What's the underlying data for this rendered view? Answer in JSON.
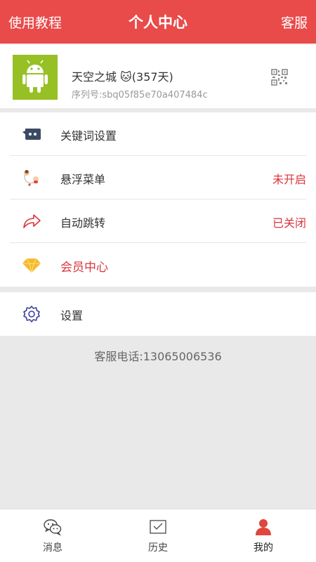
{
  "header": {
    "left_label": "使用教程",
    "title": "个人中心",
    "right_label": "客服"
  },
  "profile": {
    "name": "天空之城 🐱(357天)",
    "serial": "序列号:sbq05f85e70a407484c",
    "avatar_icon": "android-icon",
    "qr_icon": "qr-code-icon"
  },
  "menu": {
    "items": [
      {
        "label": "关键词设置",
        "status": "",
        "icon": "keyword-chat-icon"
      },
      {
        "label": "悬浮菜单",
        "status": "未开启",
        "icon": "floating-menu-icon"
      },
      {
        "label": "自动跳转",
        "status": "已关闭",
        "icon": "redirect-arrow-icon"
      },
      {
        "label": "会员中心",
        "status": "",
        "icon": "diamond-icon"
      }
    ],
    "settings": {
      "label": "设置",
      "icon": "gear-icon"
    }
  },
  "service_phone": "客服电话:13065006536",
  "tabs": [
    {
      "label": "消息",
      "icon": "wechat-icon"
    },
    {
      "label": "历史",
      "icon": "mail-icon"
    },
    {
      "label": "我的",
      "icon": "user-icon"
    }
  ],
  "colors": {
    "header_bg": "#e94a4a",
    "accent_red": "#d9363e",
    "avatar_bg": "#97c024"
  }
}
